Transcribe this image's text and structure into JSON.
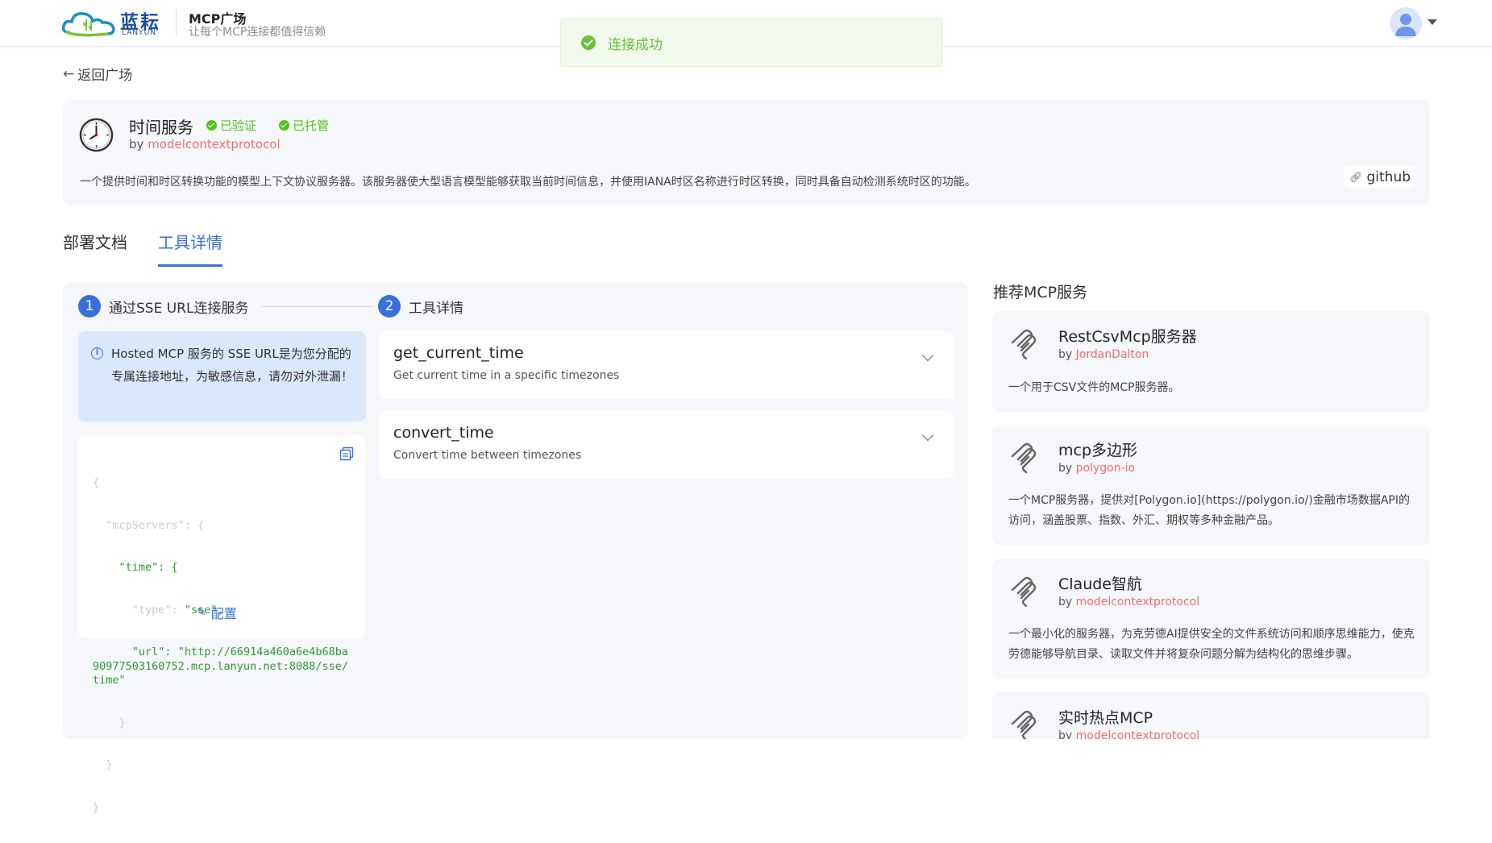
{
  "header": {
    "logo_cn": "蓝耘",
    "logo_en": "LANYUN",
    "title": "MCP广场",
    "subtitle": "让每个MCP连接都值得信赖"
  },
  "toast": {
    "text": "连接成功"
  },
  "back_link": {
    "label": "返回广场"
  },
  "service": {
    "name": "时间服务",
    "badges": [
      "已验证",
      "已托管"
    ],
    "by_prefix": "by",
    "author": "modelcontextprotocol",
    "description": "一个提供时间和时区转换功能的模型上下文协议服务器。该服务器使大型语言模型能够获取当前时间信息，并使用IANA时区名称进行时区转换，同时具备自动检测系统时区的功能。",
    "github_label": "github"
  },
  "tabs": [
    {
      "label": "部署文档",
      "active": false
    },
    {
      "label": "工具详情",
      "active": true
    }
  ],
  "steps": [
    {
      "num": "1",
      "label": "通过SSE URL连接服务"
    },
    {
      "num": "2",
      "label": "工具详情"
    }
  ],
  "alert": {
    "text": "Hosted MCP 服务的 SSE URL是为您分配的专属连接地址，为敏感信息，请勿对外泄漏！"
  },
  "code": {
    "lines": [
      {
        "text": "{",
        "cls": "k"
      },
      {
        "text": "  \"mcpServers\": {",
        "cls": "k"
      },
      {
        "text": "    \"time\": {",
        "cls": "k"
      },
      {
        "text": "      \"type\": ",
        "cls": "k",
        "value": "\"sse\","
      },
      {
        "text": "      \"url\": ",
        "cls": "k",
        "value": "\"http://66914a460a6e4b68ba90977503160752.mcp.lanyun.net:8088/sse/time\""
      },
      {
        "text": "    }",
        "cls": "k"
      },
      {
        "text": "  }",
        "cls": "k"
      },
      {
        "text": "}",
        "cls": "k"
      }
    ]
  },
  "config_button": {
    "label": "配置"
  },
  "tools": [
    {
      "name": "get_current_time",
      "description": "Get current time in a specific timezones"
    },
    {
      "name": "convert_time",
      "description": "Convert time between timezones"
    }
  ],
  "recommended": {
    "title": "推荐MCP服务",
    "items": [
      {
        "name": "RestCsvMcp服务器",
        "author": "JordanDalton",
        "description": "一个用于CSV文件的MCP服务器。"
      },
      {
        "name": "mcp多边形",
        "author": "polygon-io",
        "description": "一个MCP服务器，提供对[Polygon.io](https://polygon.io/)金融市场数据API的访问，涵盖股票、指数、外汇、期权等多种金融产品。"
      },
      {
        "name": "Claude智航",
        "author": "modelcontextprotocol",
        "description": "一个最小化的服务器，为克劳德AI提供安全的文件系统访问和顺序思维能力，使克劳德能够导航目录、读取文件并将复杂问题分解为结构化的思维步骤。"
      },
      {
        "name": "实时热点MCP",
        "author": "modelcontextprotocol",
        "description": ""
      }
    ]
  },
  "colors": {
    "accent": "#3a6fd8",
    "success": "#52c41a",
    "author": "#f56c6c"
  }
}
